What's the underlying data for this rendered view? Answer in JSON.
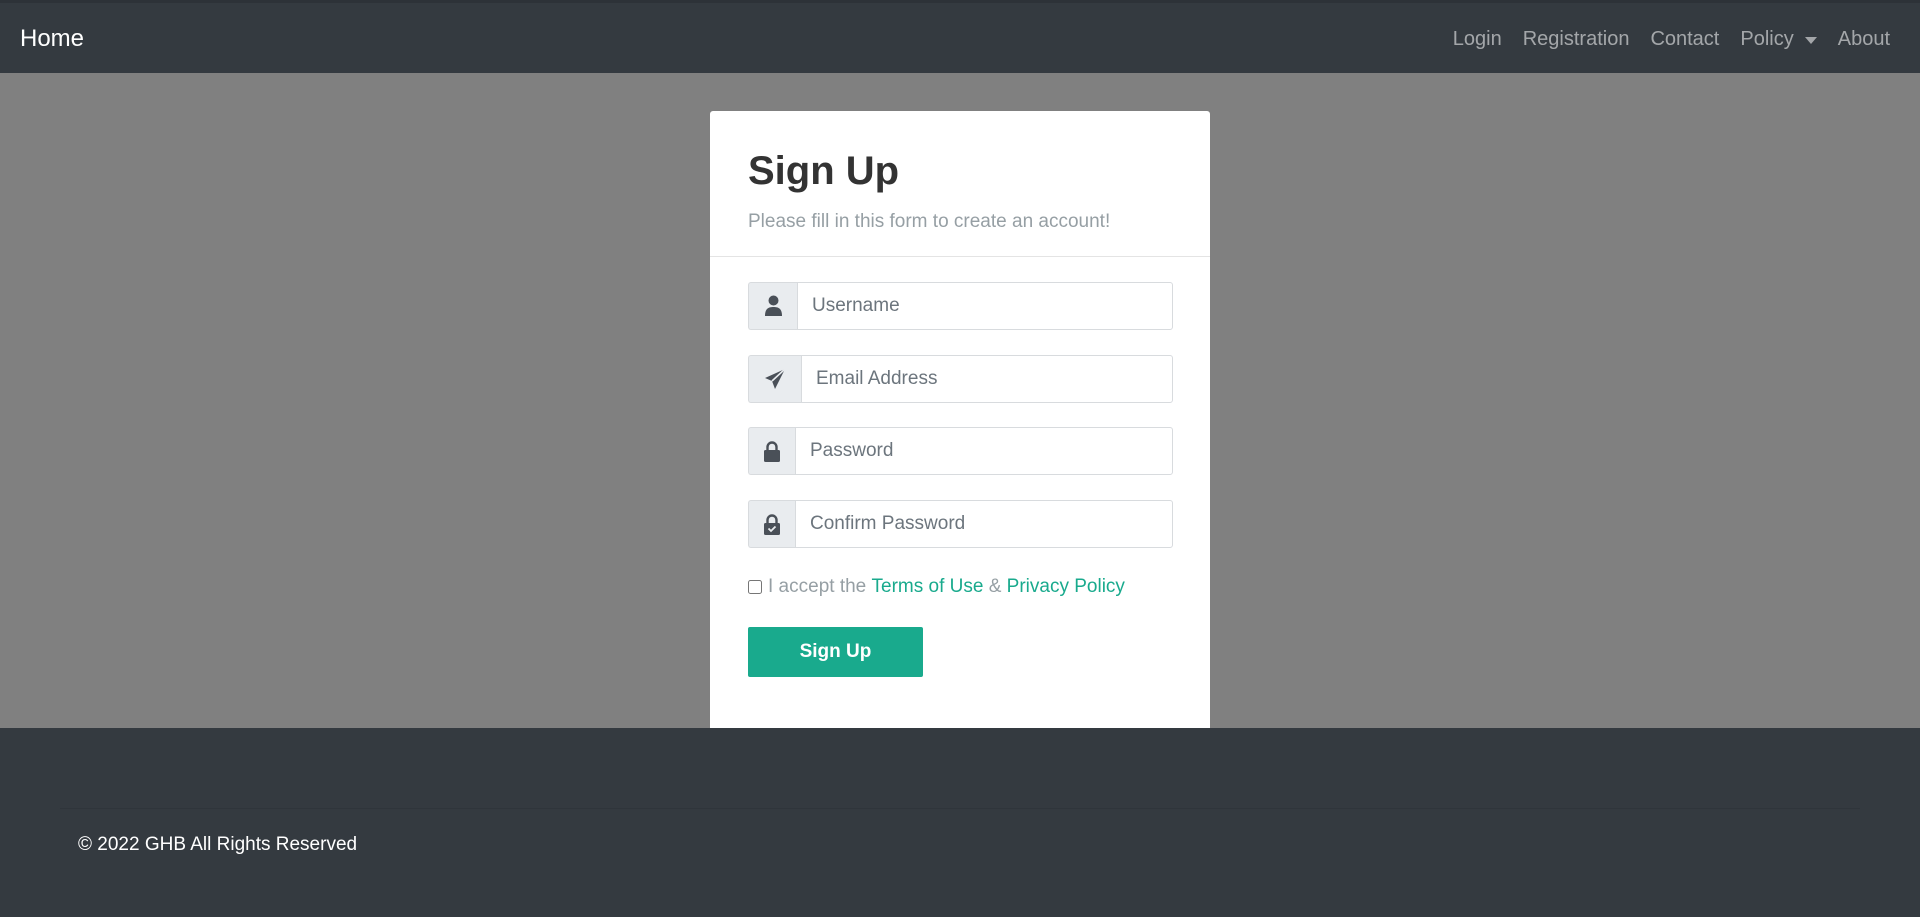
{
  "navbar": {
    "brand": "Home",
    "links": [
      "Login",
      "Registration",
      "Contact",
      "Policy",
      "About"
    ]
  },
  "form": {
    "title": "Sign Up",
    "subtitle": "Please fill in this form to create an account!",
    "username_placeholder": "Username",
    "email_placeholder": "Email Address",
    "password_placeholder": "Password",
    "confirm_placeholder": "Confirm Password",
    "terms_prefix": "I accept the ",
    "terms_link": "Terms of Use",
    "terms_amp": " & ",
    "privacy_link": "Privacy Policy",
    "submit_label": "Sign Up"
  },
  "footer": {
    "copyright": "© 2022 GHB All Rights Reserved"
  },
  "colors": {
    "navbar_bg": "#343a40",
    "page_bg": "#808080",
    "accent": "#19aa8d"
  },
  "icons": [
    "user-icon",
    "paper-plane-icon",
    "lock-icon",
    "lock-check-icon",
    "caret-down-icon"
  ]
}
